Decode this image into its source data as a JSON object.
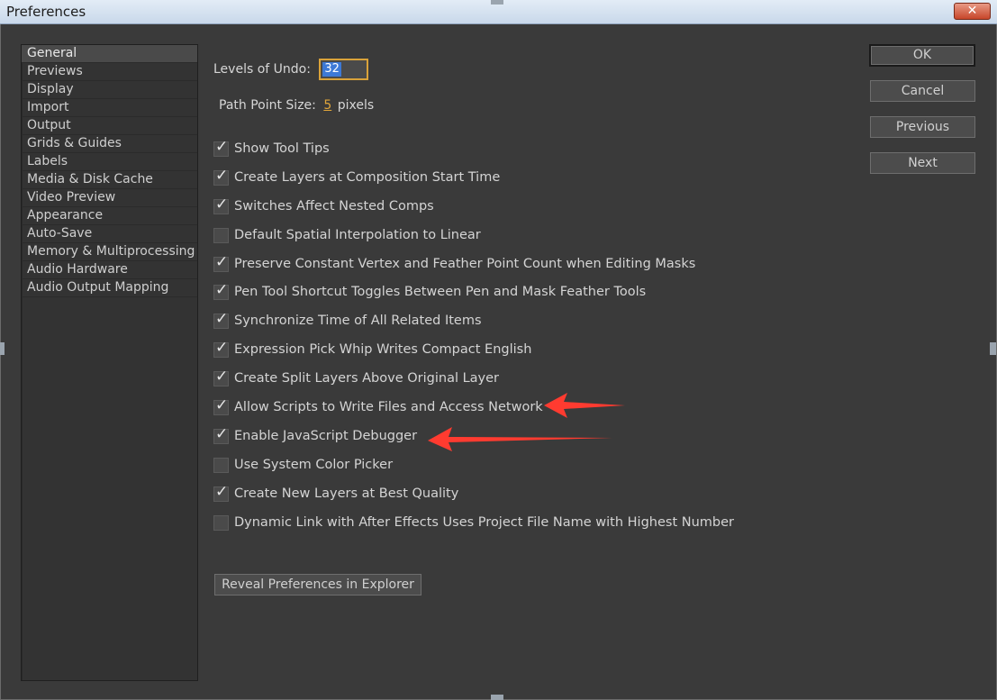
{
  "window": {
    "title": "Preferences",
    "close_label": "✕"
  },
  "sidebar": {
    "items": [
      "General",
      "Previews",
      "Display",
      "Import",
      "Output",
      "Grids & Guides",
      "Labels",
      "Media & Disk Cache",
      "Video Preview",
      "Appearance",
      "Auto-Save",
      "Memory & Multiprocessing",
      "Audio Hardware",
      "Audio Output Mapping"
    ],
    "selected": "General"
  },
  "general": {
    "levels_of_undo_label": "Levels of Undo:",
    "levels_of_undo_value": "32",
    "path_point_size_label": "Path Point Size:",
    "path_point_size_value": "5",
    "path_point_size_unit": "pixels",
    "options": [
      {
        "label": "Show Tool Tips",
        "checked": true
      },
      {
        "label": "Create Layers at Composition Start Time",
        "checked": true
      },
      {
        "label": "Switches Affect Nested Comps",
        "checked": true
      },
      {
        "label": "Default Spatial Interpolation to Linear",
        "checked": false
      },
      {
        "label": "Preserve Constant Vertex and Feather Point Count when Editing Masks",
        "checked": true
      },
      {
        "label": "Pen Tool Shortcut Toggles Between Pen and Mask Feather Tools",
        "checked": true
      },
      {
        "label": "Synchronize Time of All Related Items",
        "checked": true
      },
      {
        "label": "Expression Pick Whip Writes Compact English",
        "checked": true
      },
      {
        "label": "Create Split Layers Above Original Layer",
        "checked": true
      },
      {
        "label": "Allow Scripts to Write Files and Access Network",
        "checked": true
      },
      {
        "label": "Enable JavaScript Debugger",
        "checked": true
      },
      {
        "label": "Use System Color Picker",
        "checked": false
      },
      {
        "label": "Create New Layers at Best Quality",
        "checked": true
      },
      {
        "label": "Dynamic Link with After Effects Uses Project File Name with Highest Number",
        "checked": false
      }
    ],
    "reveal_button": "Reveal Preferences in Explorer"
  },
  "buttons": {
    "ok": "OK",
    "cancel": "Cancel",
    "previous": "Previous",
    "next": "Next"
  },
  "annotation": {
    "arrow_color": "#ff3b30",
    "arrow_icon": "red-arrow-icon"
  }
}
